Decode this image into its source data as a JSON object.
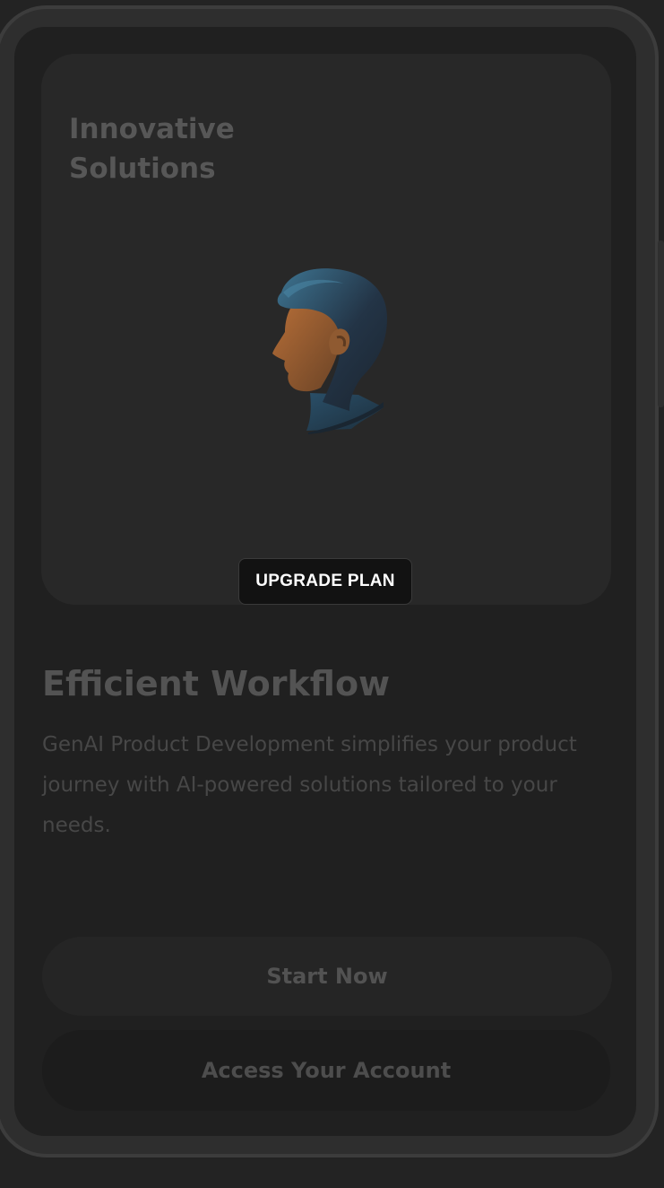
{
  "hero": {
    "title_line1": "Innovative",
    "title_line2": "Solutions",
    "illustration": "profile-head-illustration",
    "upgrade_label": "UPGRADE PLAN"
  },
  "content": {
    "heading": "Efficient Workflow",
    "description": "GenAI Product Development simplifies your product journey with AI-powered solutions tailored to your needs."
  },
  "actions": {
    "start_label": "Start Now",
    "account_label": "Access Your Account"
  },
  "colors": {
    "page_background": "#232323",
    "screen_background": "#202020",
    "card_background": "#282828",
    "upgrade_button_background": "#121212",
    "upgrade_button_text": "#ffffff",
    "hair_blue": "#3a6a88",
    "skin_orange": "#b06a36"
  }
}
